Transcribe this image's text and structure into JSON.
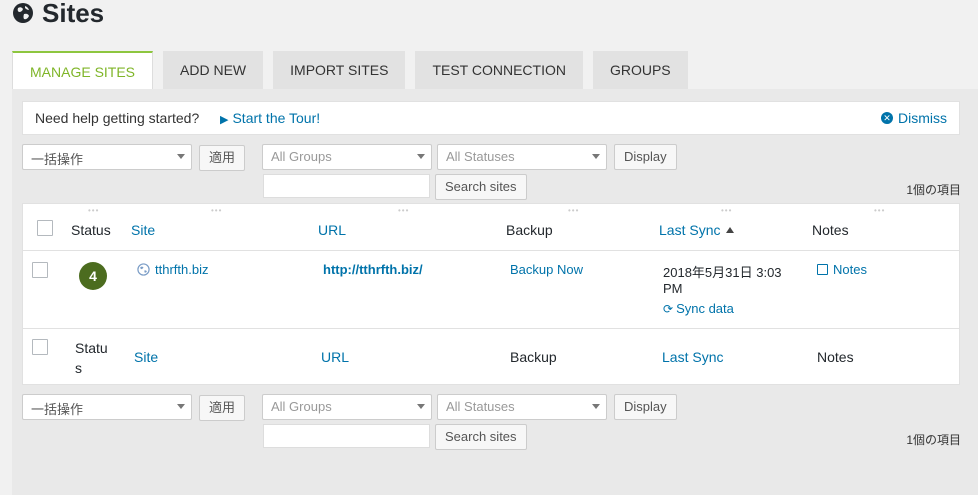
{
  "page": {
    "title": "Sites"
  },
  "tabs": [
    {
      "label": "MANAGE SITES",
      "active": true
    },
    {
      "label": "ADD NEW",
      "active": false
    },
    {
      "label": "IMPORT SITES",
      "active": false
    },
    {
      "label": "TEST CONNECTION",
      "active": false
    },
    {
      "label": "GROUPS",
      "active": false
    }
  ],
  "help": {
    "text": "Need help getting started?",
    "tour_label": "Start the Tour!",
    "dismiss_label": "Dismiss"
  },
  "top_controls": {
    "bulk_action": "一括操作",
    "apply": "適用",
    "groups": "All Groups",
    "statuses": "All Statuses",
    "display": "Display",
    "search_value": "",
    "search_button": "Search sites",
    "items_count": "1個の項目"
  },
  "table": {
    "headers": {
      "status": "Status",
      "site": "Site",
      "url": "URL",
      "backup": "Backup",
      "last_sync": "Last Sync",
      "notes": "Notes"
    },
    "rows": [
      {
        "status_count": "4",
        "site": "tthrfth.biz",
        "url": "http://tthrfth.biz/",
        "backup": "Backup Now",
        "last_sync_line1": "2018年5月31日 3:03",
        "last_sync_line2": "PM",
        "sync_action": "Sync data",
        "notes": "Notes"
      }
    ],
    "footers": {
      "status_line1": "Statu",
      "status_line2": "s",
      "site": "Site",
      "url": "URL",
      "backup": "Backup",
      "last_sync": "Last Sync",
      "notes": "Notes"
    }
  },
  "bottom_controls": {
    "bulk_action": "一括操作",
    "apply": "適用",
    "groups": "All Groups",
    "statuses": "All Statuses",
    "display": "Display",
    "search_value": "",
    "search_button": "Search sites",
    "items_count": "1個の項目"
  },
  "colors": {
    "accent_green": "#7fb528",
    "badge_green": "#4c6c1f",
    "link_blue": "#0073aa"
  }
}
